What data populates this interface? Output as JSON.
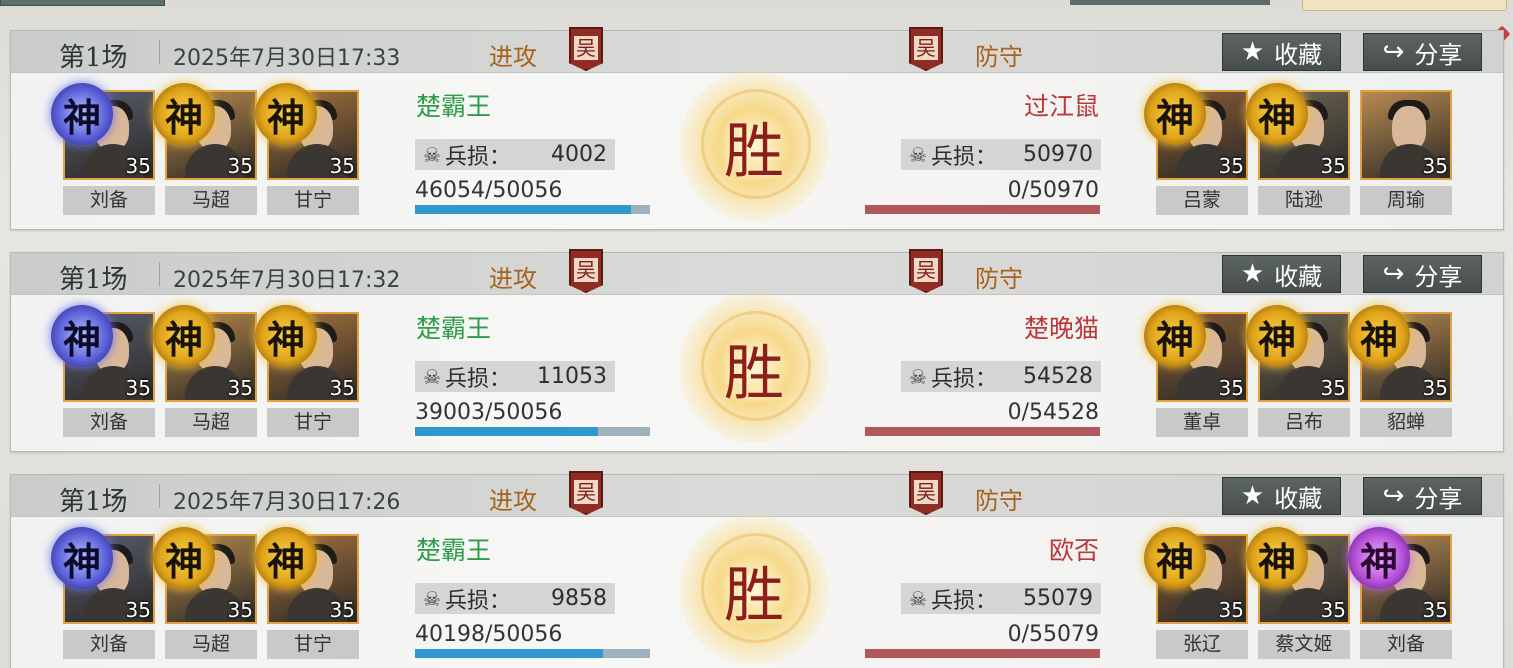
{
  "colors": {
    "attack_green": "#2e9b4a",
    "defend_red": "#b8393a",
    "side_label": "#a7621d",
    "bar_blue": "#2f98cf",
    "bar_red": "#a8454b"
  },
  "records": [
    {
      "match": "第1场",
      "time": "2025年7月30日17:33",
      "attack_label": "进攻",
      "defend_label": "防守",
      "attack_faction": "吴",
      "defend_faction": "吴",
      "fav_label": "收藏",
      "share_label": "分享",
      "fav_icon": "star-icon",
      "share_icon": "share-icon",
      "result": "胜",
      "attacker": {
        "name": "楚霸王",
        "loss_label": "兵损：",
        "loss": "4002",
        "troops": "46054/50056",
        "troops_ratio": 0.92,
        "heroes": [
          {
            "name": "刘备",
            "badge": "神",
            "level": "35",
            "tier": "blue"
          },
          {
            "name": "马超",
            "badge": "神",
            "level": "35",
            "tier": "gold"
          },
          {
            "name": "甘宁",
            "badge": "神",
            "level": "35",
            "tier": "gold"
          }
        ]
      },
      "defender": {
        "name": "过江鼠",
        "loss_label": "兵损：",
        "loss": "50970",
        "troops": "0/50970",
        "troops_ratio": 0,
        "heroes": [
          {
            "name": "吕蒙",
            "badge": "神",
            "level": "35",
            "tier": "gold"
          },
          {
            "name": "陆逊",
            "badge": "神",
            "level": "35",
            "tier": "gold"
          },
          {
            "name": "周瑜",
            "badge": "",
            "level": "35",
            "tier": "none"
          }
        ]
      }
    },
    {
      "match": "第1场",
      "time": "2025年7月30日17:32",
      "attack_label": "进攻",
      "defend_label": "防守",
      "attack_faction": "吴",
      "defend_faction": "吴",
      "fav_label": "收藏",
      "share_label": "分享",
      "fav_icon": "star-icon",
      "share_icon": "share-icon",
      "result": "胜",
      "attacker": {
        "name": "楚霸王",
        "loss_label": "兵损：",
        "loss": "11053",
        "troops": "39003/50056",
        "troops_ratio": 0.78,
        "heroes": [
          {
            "name": "刘备",
            "badge": "神",
            "level": "35",
            "tier": "blue"
          },
          {
            "name": "马超",
            "badge": "神",
            "level": "35",
            "tier": "gold"
          },
          {
            "name": "甘宁",
            "badge": "神",
            "level": "35",
            "tier": "gold"
          }
        ]
      },
      "defender": {
        "name": "楚晚猫",
        "loss_label": "兵损：",
        "loss": "54528",
        "troops": "0/54528",
        "troops_ratio": 0,
        "heroes": [
          {
            "name": "董卓",
            "badge": "神",
            "level": "35",
            "tier": "gold"
          },
          {
            "name": "吕布",
            "badge": "神",
            "level": "35",
            "tier": "gold"
          },
          {
            "name": "貂蝉",
            "badge": "神",
            "level": "35",
            "tier": "gold"
          }
        ]
      }
    },
    {
      "match": "第1场",
      "time": "2025年7月30日17:26",
      "attack_label": "进攻",
      "defend_label": "防守",
      "attack_faction": "吴",
      "defend_faction": "吴",
      "fav_label": "收藏",
      "share_label": "分享",
      "fav_icon": "star-icon",
      "share_icon": "share-icon",
      "result": "胜",
      "attacker": {
        "name": "楚霸王",
        "loss_label": "兵损：",
        "loss": "9858",
        "troops": "40198/50056",
        "troops_ratio": 0.8,
        "heroes": [
          {
            "name": "刘备",
            "badge": "神",
            "level": "35",
            "tier": "blue"
          },
          {
            "name": "马超",
            "badge": "神",
            "level": "35",
            "tier": "gold"
          },
          {
            "name": "甘宁",
            "badge": "神",
            "level": "35",
            "tier": "gold"
          }
        ]
      },
      "defender": {
        "name": "欧否",
        "loss_label": "兵损：",
        "loss": "55079",
        "troops": "0/55079",
        "troops_ratio": 0,
        "heroes": [
          {
            "name": "张辽",
            "badge": "神",
            "level": "35",
            "tier": "gold"
          },
          {
            "name": "蔡文姬",
            "badge": "神",
            "level": "35",
            "tier": "gold"
          },
          {
            "name": "刘备",
            "badge": "神",
            "level": "35",
            "tier": "purple"
          }
        ]
      }
    }
  ]
}
